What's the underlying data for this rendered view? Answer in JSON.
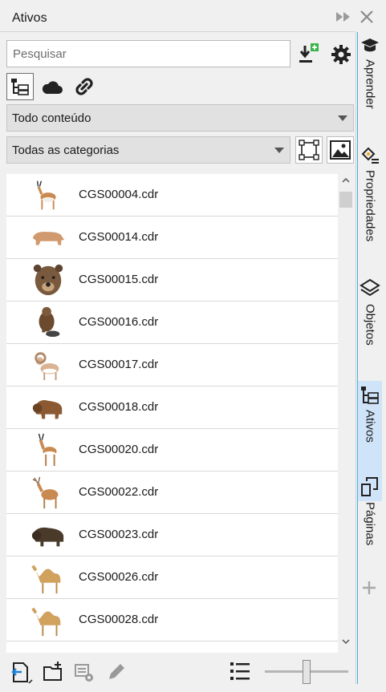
{
  "panel": {
    "title": "Ativos"
  },
  "search": {
    "placeholder": "Pesquisar"
  },
  "filters": {
    "content": "Todo conteúdo",
    "category": "Todas as categorias"
  },
  "assets": [
    {
      "name": "CGS00004.cdr",
      "animal": "pronghorn"
    },
    {
      "name": "CGS00014.cdr",
      "animal": "bear"
    },
    {
      "name": "CGS00015.cdr",
      "animal": "bear-head"
    },
    {
      "name": "CGS00016.cdr",
      "animal": "beaver"
    },
    {
      "name": "CGS00017.cdr",
      "animal": "bighorn-sheep"
    },
    {
      "name": "CGS00018.cdr",
      "animal": "bison"
    },
    {
      "name": "CGS00020.cdr",
      "animal": "springbok"
    },
    {
      "name": "CGS00022.cdr",
      "animal": "deer"
    },
    {
      "name": "CGS00023.cdr",
      "animal": "buffalo"
    },
    {
      "name": "CGS00026.cdr",
      "animal": "camel"
    },
    {
      "name": "CGS00028.cdr",
      "animal": "camel"
    }
  ],
  "dock": {
    "tabs": [
      {
        "label": "Aprender",
        "icon": "graduation-cap-icon"
      },
      {
        "label": "Propriedades",
        "icon": "properties-icon"
      },
      {
        "label": "Objetos",
        "icon": "layers-icon"
      },
      {
        "label": "Ativos",
        "icon": "assets-icon"
      },
      {
        "label": "Páginas",
        "icon": "pages-icon"
      }
    ]
  },
  "colors": {
    "accent": "#3fb3e8",
    "active_tab": "#cfe4f9",
    "download_green": "#3bb34a"
  }
}
